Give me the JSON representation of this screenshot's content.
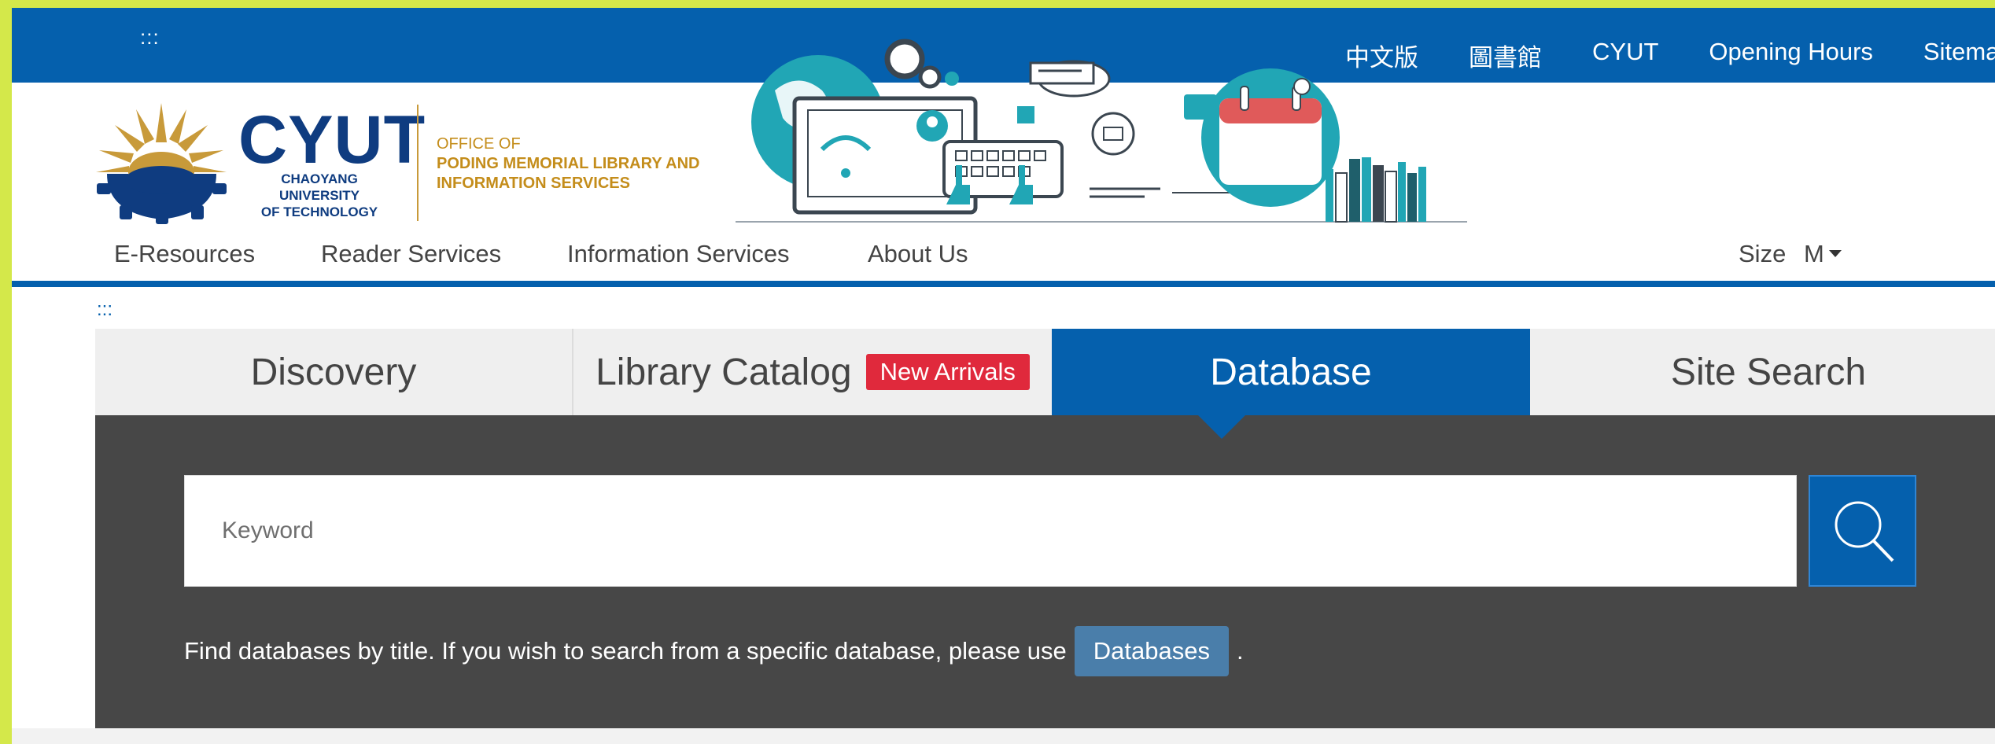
{
  "topbar": {
    "skip_link": ":::",
    "links": [
      "中文版",
      "圖書館",
      "CYUT",
      "Opening Hours",
      "Sitemap"
    ]
  },
  "header": {
    "logo_big": "CYUT",
    "logo_sub_line1": "CHAOYANG UNIVERSITY",
    "logo_sub_line2": "OF TECHNOLOGY",
    "office_line1": "OFFICE OF",
    "office_line2": "PODING MEMORIAL LIBRARY AND",
    "office_line3": "INFORMATION SERVICES"
  },
  "nav": {
    "items": [
      "E-Resources",
      "Reader Services",
      "Information Services",
      "About Us"
    ],
    "size_label": "Size",
    "size_value": "M"
  },
  "content": {
    "skip_link": ":::"
  },
  "tabs": [
    {
      "label": "Discovery"
    },
    {
      "label": "Library Catalog",
      "badge": "New Arrivals"
    },
    {
      "label": "Database"
    },
    {
      "label": "Site Search"
    }
  ],
  "active_tab": "Database",
  "search": {
    "placeholder": "Keyword",
    "hint_text": "Find databases by title. If you wish to search from a specific database, please use",
    "databases_button": "Databases",
    "hint_end": "."
  },
  "colors": {
    "primary": "#0560ad",
    "panel": "#474747",
    "badge": "#e0293c",
    "logo_gold": "#c48d1b",
    "logo_navy": "#0f3c80",
    "frame_border": "#d4e84a"
  }
}
